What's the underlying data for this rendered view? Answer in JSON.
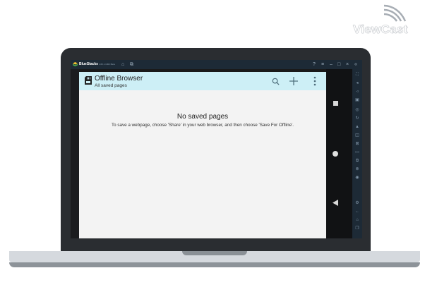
{
  "brand": {
    "name": "ViewCast"
  },
  "emulator": {
    "title": "BlueStacks",
    "version": "4.60.1.1002 Beta",
    "header_icons": [
      "home-icon",
      "multi-instance-icon"
    ],
    "window_controls": [
      "help-icon",
      "menu-icon",
      "minimize-icon",
      "restore-icon",
      "close-icon",
      "collapse-icon"
    ],
    "sidebar_icons": [
      "fullscreen-icon",
      "volume-up-icon",
      "volume-down-icon",
      "keymap-icon",
      "eye-icon",
      "rotate-icon",
      "shake-icon",
      "screenshot-icon",
      "record-icon",
      "folder-icon",
      "multi-instance-icon",
      "macro-icon",
      "location-icon",
      "settings-icon",
      "back-icon",
      "home-icon",
      "recent-icon"
    ]
  },
  "app": {
    "title": "Offline Browser",
    "subtitle": "All saved pages",
    "actions": [
      "search-icon",
      "add-icon",
      "overflow-menu-icon"
    ]
  },
  "empty_state": {
    "title": "No saved pages",
    "message": "To save a webpage, choose 'Share' in your web browser, and then choose 'Save For Offline'."
  },
  "colors": {
    "appbar": "#cdeff6",
    "emulator_chrome": "#1d2a36",
    "laptop_body": "#2a2d31"
  }
}
